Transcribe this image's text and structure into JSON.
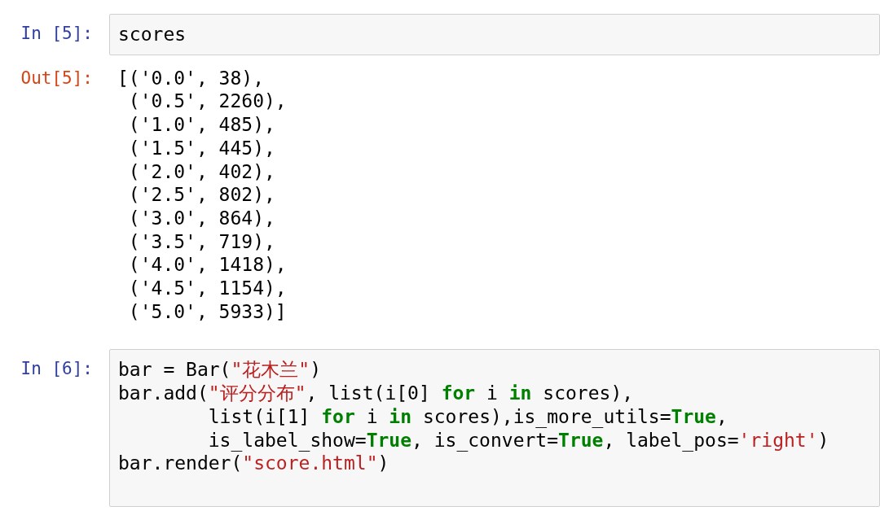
{
  "cells": [
    {
      "kind": "input",
      "prompt": "In [5]:",
      "lines": [
        [
          {
            "text": "scores",
            "kind": "plain"
          }
        ]
      ]
    },
    {
      "kind": "output",
      "prompt": "Out[5]:",
      "lines": [
        [
          {
            "text": "[('0.0', 38),",
            "kind": "plain"
          }
        ],
        [
          {
            "text": " ('0.5', 2260),",
            "kind": "plain"
          }
        ],
        [
          {
            "text": " ('1.0', 485),",
            "kind": "plain"
          }
        ],
        [
          {
            "text": " ('1.5', 445),",
            "kind": "plain"
          }
        ],
        [
          {
            "text": " ('2.0', 402),",
            "kind": "plain"
          }
        ],
        [
          {
            "text": " ('2.5', 802),",
            "kind": "plain"
          }
        ],
        [
          {
            "text": " ('3.0', 864),",
            "kind": "plain"
          }
        ],
        [
          {
            "text": " ('3.5', 719),",
            "kind": "plain"
          }
        ],
        [
          {
            "text": " ('4.0', 1418),",
            "kind": "plain"
          }
        ],
        [
          {
            "text": " ('4.5', 1154),",
            "kind": "plain"
          }
        ],
        [
          {
            "text": " ('5.0', 5933)]",
            "kind": "plain"
          }
        ]
      ]
    },
    {
      "kind": "input",
      "prompt": "In [6]:",
      "lines": [
        [
          {
            "text": "bar = Bar(",
            "kind": "plain"
          },
          {
            "text": "\"花木兰\"",
            "kind": "string"
          },
          {
            "text": ")",
            "kind": "plain"
          }
        ],
        [
          {
            "text": "bar.add(",
            "kind": "plain"
          },
          {
            "text": "\"评分分布\"",
            "kind": "string"
          },
          {
            "text": ", list(i[0] ",
            "kind": "plain"
          },
          {
            "text": "for",
            "kind": "keyword"
          },
          {
            "text": " i ",
            "kind": "plain"
          },
          {
            "text": "in",
            "kind": "keyword"
          },
          {
            "text": " scores),",
            "kind": "plain"
          }
        ],
        [
          {
            "text": "        list(i[1] ",
            "kind": "plain"
          },
          {
            "text": "for",
            "kind": "keyword"
          },
          {
            "text": " i ",
            "kind": "plain"
          },
          {
            "text": "in",
            "kind": "keyword"
          },
          {
            "text": " scores),is_more_utils=",
            "kind": "plain"
          },
          {
            "text": "True",
            "kind": "keyword"
          },
          {
            "text": ",",
            "kind": "plain"
          }
        ],
        [
          {
            "text": "        is_label_show=",
            "kind": "plain"
          },
          {
            "text": "True",
            "kind": "keyword"
          },
          {
            "text": ", is_convert=",
            "kind": "plain"
          },
          {
            "text": "True",
            "kind": "keyword"
          },
          {
            "text": ", label_pos=",
            "kind": "plain"
          },
          {
            "text": "'right'",
            "kind": "string"
          },
          {
            "text": ")",
            "kind": "plain"
          }
        ],
        [
          {
            "text": "bar.render(",
            "kind": "plain"
          },
          {
            "text": "\"score.html\"",
            "kind": "string"
          },
          {
            "text": ")",
            "kind": "plain"
          }
        ]
      ]
    }
  ]
}
